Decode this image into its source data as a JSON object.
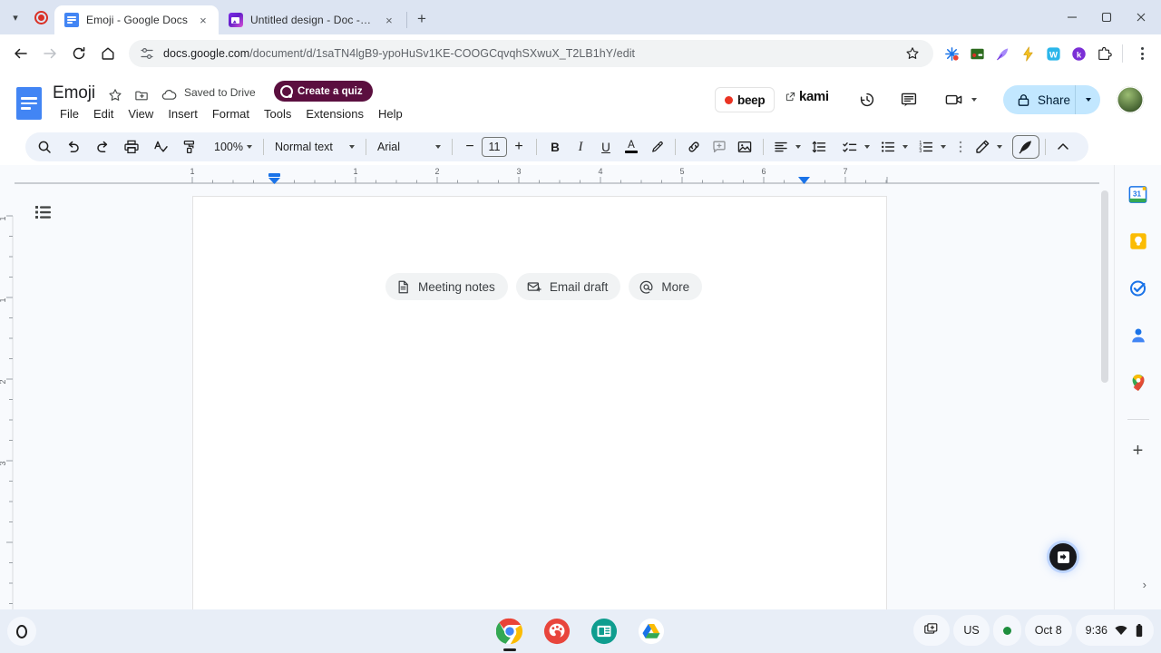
{
  "browser": {
    "tabs": [
      {
        "title": "Emoji - Google Docs",
        "favicon": "google-docs-icon",
        "active": true
      },
      {
        "title": "Untitled design - Doc - Canva",
        "favicon": "canva-icon",
        "active": false
      }
    ],
    "new_tab_label": "+",
    "tab_close_label": "×",
    "recording_indicator": "record-icon",
    "window": {
      "minimize": "–",
      "maximize": "❐",
      "close": "✕"
    },
    "omnibox": {
      "url_domain": "docs.google.com",
      "url_path": "/document/d/1saTN4lgB9-ypoHuSv1KE-COOGCqvqhSXwuX_T2LB1hY/edit",
      "site_info_icon": "site-settings-icon",
      "bookmark_icon": "star-icon"
    },
    "extensions": [
      {
        "name": "grammarly-extension",
        "glyph": "✺"
      },
      {
        "name": "screen-recorder-extension",
        "glyph": "▬"
      },
      {
        "name": "quill-extension",
        "glyph": "✒"
      },
      {
        "name": "lightning-extension",
        "glyph": "⚡"
      },
      {
        "name": "wordtune-extension",
        "glyph": "W"
      },
      {
        "name": "kami-extension",
        "glyph": "K"
      },
      {
        "name": "extensions-puzzle-icon",
        "glyph": "⧉"
      }
    ],
    "menu_icon": "kebab-menu-icon",
    "profile_icon": "profile-avatar"
  },
  "docs": {
    "title": "Emoji",
    "logo": "google-docs-logo",
    "star_label": "☆",
    "move_label": "move-to-folder-icon",
    "saved_status": "Saved to Drive",
    "quiz_button": "Create a quiz",
    "menus": [
      "File",
      "Edit",
      "View",
      "Insert",
      "Format",
      "Tools",
      "Extensions",
      "Help"
    ],
    "beep_label": "beep",
    "kami_label": "kami",
    "history_icon": "version-history-icon",
    "comments_icon": "comment-icon",
    "meet_icon": "video-camera-icon",
    "share_label": "Share",
    "share_lock_icon": "lock-icon",
    "user_avatar": "account-avatar"
  },
  "toolbar": {
    "search": "search-icon",
    "undo": "undo-icon",
    "redo": "redo-icon",
    "print": "print-icon",
    "spellcheck": "spellcheck-icon",
    "paint_format": "paint-format-icon",
    "zoom_value": "100%",
    "style_value": "Normal text",
    "font_value": "Arial",
    "font_decrease": "−",
    "font_size": "11",
    "font_increase": "+",
    "bold": "B",
    "italic": "I",
    "underline": "U",
    "text_color": "A",
    "highlight": "highlight-pen-icon",
    "insert_link": "link-icon",
    "add_comment": "add-comment-icon",
    "insert_image": "insert-image-icon",
    "align": "align-left-icon",
    "line_spacing": "line-spacing-icon",
    "checklist": "checklist-icon",
    "bulleted_list": "bulleted-list-icon",
    "numbered_list": "numbered-list-icon",
    "more_options": "more-options-icon",
    "editing_mode": "editing-pencil-icon",
    "feather_mode": "feather-pen-icon",
    "collapse": "collapse-toolbar-icon"
  },
  "ruler": {
    "horizontal_labels": [
      "1",
      "1",
      "2",
      "3",
      "4",
      "5",
      "6",
      "7"
    ],
    "vertical_labels": [
      "1",
      "1",
      "2",
      "3"
    ],
    "indent_marker": "indent-marker",
    "right_margin_marker": "right-margin-marker"
  },
  "document": {
    "outline_button": "document-outline-icon",
    "chips": [
      {
        "label": "Meeting notes",
        "icon": "document-icon"
      },
      {
        "label": "Email draft",
        "icon": "email-icon"
      },
      {
        "label": "More",
        "icon": "at-sign-icon"
      }
    ]
  },
  "side_panel": {
    "items": [
      {
        "name": "google-calendar-icon",
        "label": "31"
      },
      {
        "name": "google-keep-icon",
        "label": ""
      },
      {
        "name": "google-tasks-icon",
        "label": ""
      },
      {
        "name": "google-contacts-icon",
        "label": ""
      },
      {
        "name": "google-maps-icon",
        "label": ""
      }
    ],
    "add_label": "+",
    "expand_label": "›"
  },
  "floating": {
    "assistant_button": "assistant-fab-icon"
  },
  "shelf": {
    "launcher": "launcher-icon",
    "apps": [
      {
        "name": "chrome-app",
        "running": true
      },
      {
        "name": "palette-app",
        "running": false
      },
      {
        "name": "slides-app",
        "running": false
      },
      {
        "name": "google-drive-app",
        "running": false
      }
    ],
    "tray": {
      "new_desk": "new-desk-icon",
      "keyboard_layout": "US",
      "status_dot": "status-indicator",
      "date": "Oct 8",
      "time": "9:36",
      "wifi": "wifi-icon",
      "battery": "battery-icon"
    }
  },
  "colors": {
    "chrome_tabstrip": "#dce4f2",
    "docs_blue": "#4285f4",
    "toolbar_bg": "#edf2fa",
    "share_bg": "#c2e7ff",
    "quiz_bg": "#5b0f3f",
    "shelf_bg": "#e8eef7"
  }
}
